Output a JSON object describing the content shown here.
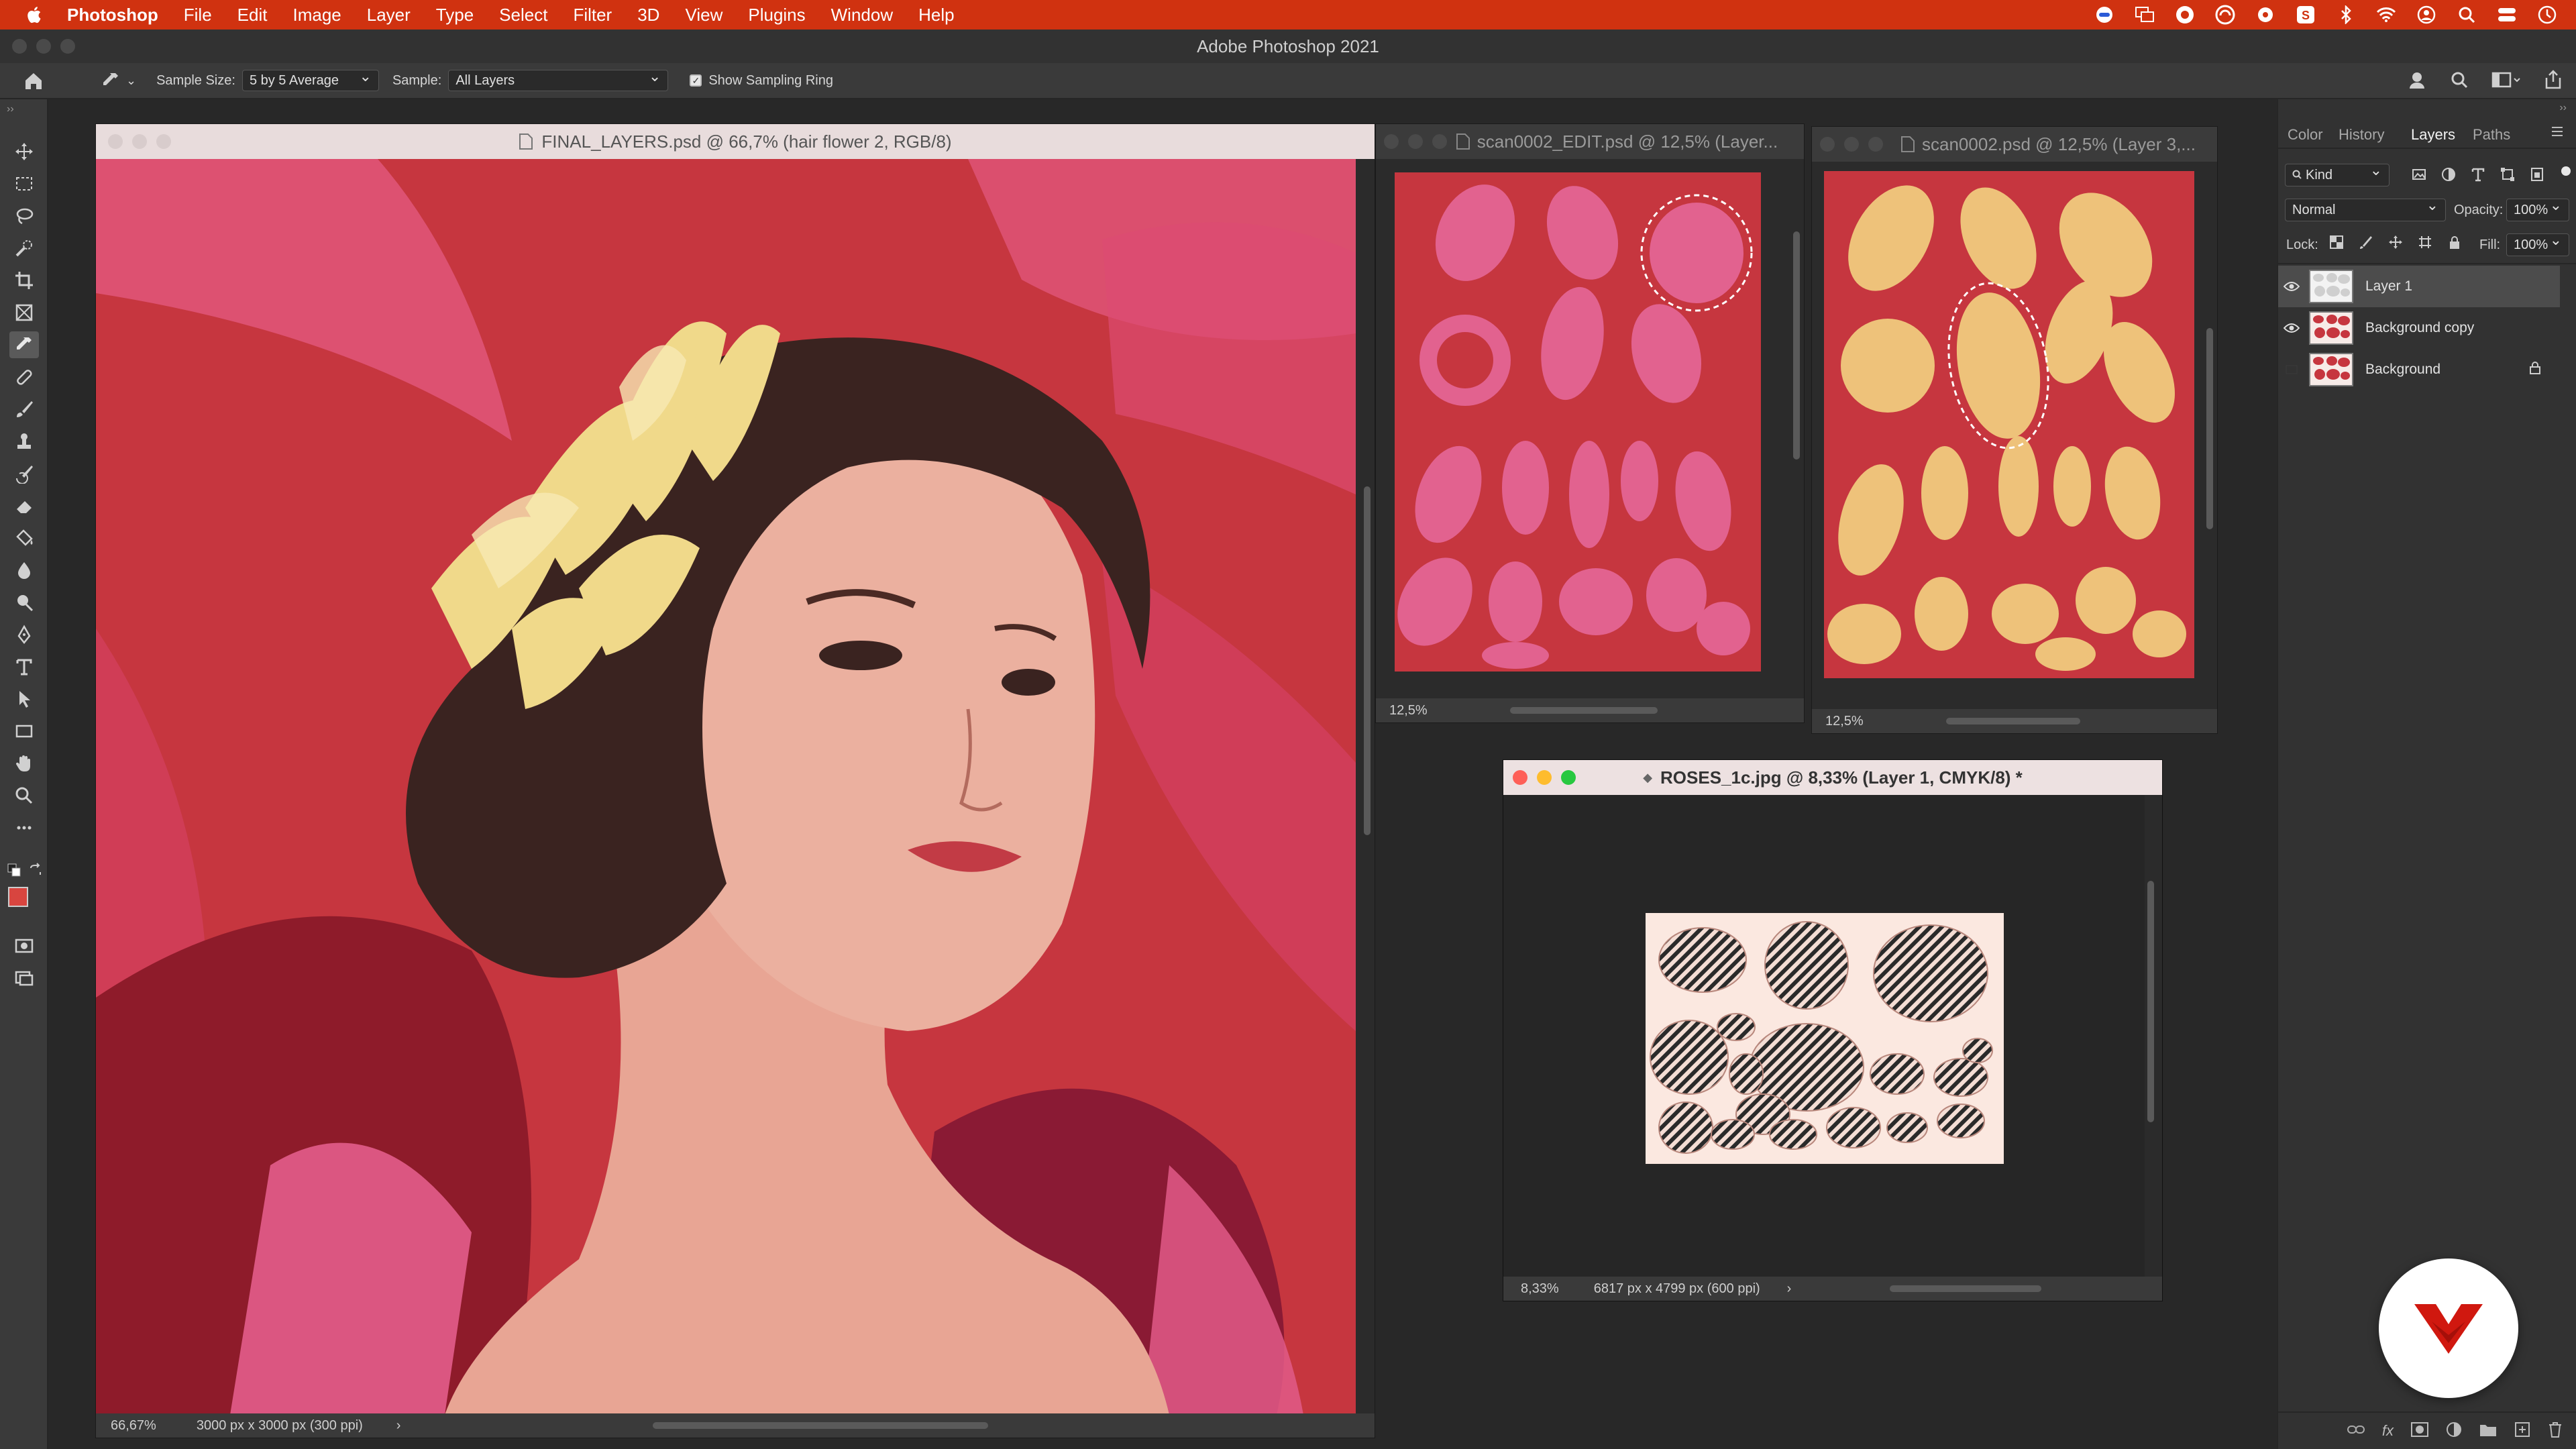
{
  "menubar": {
    "app_name": "Photoshop",
    "items": [
      "File",
      "Edit",
      "Image",
      "Layer",
      "Type",
      "Select",
      "Filter",
      "3D",
      "View",
      "Plugins",
      "Window",
      "Help"
    ]
  },
  "app_title": "Adobe Photoshop 2021",
  "options_bar": {
    "sample_size_label": "Sample Size:",
    "sample_size_value": "5 by 5 Average",
    "sample_label": "Sample:",
    "sample_value": "All Layers",
    "show_ring_label": "Show Sampling Ring",
    "show_ring_checked": true
  },
  "documents": [
    {
      "title": "FINAL_LAYERS.psd @ 66,7% (hair flower 2, RGB/8)",
      "zoom": "66,67%",
      "dimensions": "3000 px x 3000 px (300 ppi)"
    },
    {
      "title": "scan0002_EDIT.psd @ 12,5% (Layer...",
      "zoom": "12,5%"
    },
    {
      "title": "scan0002.psd @ 12,5% (Layer 3,...",
      "zoom": "12,5%"
    },
    {
      "title": "ROSES_1c.jpg @ 8,33% (Layer 1, CMYK/8) *",
      "zoom": "8,33%",
      "dimensions": "6817 px x 4799 px (600 ppi)"
    }
  ],
  "panel": {
    "tabs": [
      "Color",
      "History",
      "Layers",
      "Paths"
    ],
    "active_tab": "Layers",
    "filter_kind": "Kind",
    "blend_mode": "Normal",
    "opacity_label": "Opacity:",
    "opacity_value": "100%",
    "lock_label": "Lock:",
    "fill_label": "Fill:",
    "fill_value": "100%",
    "layers": [
      {
        "name": "Layer 1",
        "visible": true,
        "selected": true,
        "locked": false
      },
      {
        "name": "Background copy",
        "visible": true,
        "selected": false,
        "locked": false
      },
      {
        "name": "Background",
        "visible": false,
        "selected": false,
        "locked": true
      }
    ]
  },
  "colors": {
    "menubar": "#d03210",
    "canvas_red": "#c6363f",
    "foreground_swatch": "#d8453f",
    "background_swatch": "#ffffff",
    "logo_red": "#d0180f"
  }
}
